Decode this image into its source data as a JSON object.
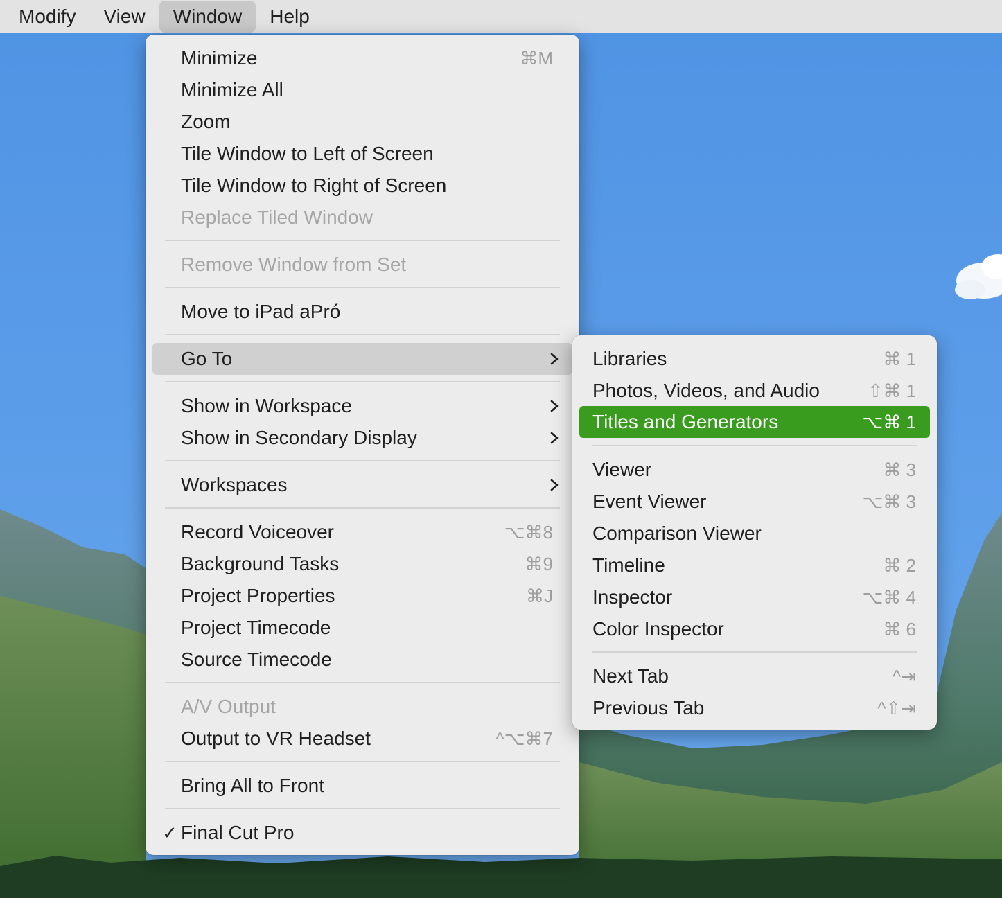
{
  "menubar": {
    "items": [
      {
        "label": "Modify"
      },
      {
        "label": "View"
      },
      {
        "label": "Window"
      },
      {
        "label": "Help"
      }
    ]
  },
  "window_menu": {
    "items": [
      {
        "label": "Minimize",
        "shortcut": "⌘M"
      },
      {
        "label": "Minimize All"
      },
      {
        "label": "Zoom"
      },
      {
        "label": "Tile Window to Left of Screen"
      },
      {
        "label": "Tile Window to Right of Screen"
      },
      {
        "label": "Replace Tiled Window",
        "disabled": true
      },
      {
        "label": "Remove Window from Set",
        "disabled": true
      },
      {
        "label": "Move to iPad aPró"
      },
      {
        "label": "Go To",
        "submenu": true,
        "highlighted": true
      },
      {
        "label": "Show in Workspace",
        "submenu": true
      },
      {
        "label": "Show in Secondary Display",
        "submenu": true
      },
      {
        "label": "Workspaces",
        "submenu": true
      },
      {
        "label": "Record Voiceover",
        "shortcut": "⌥⌘8"
      },
      {
        "label": "Background Tasks",
        "shortcut": "⌘9"
      },
      {
        "label": "Project Properties",
        "shortcut": "⌘J"
      },
      {
        "label": "Project Timecode"
      },
      {
        "label": "Source Timecode"
      },
      {
        "label": "A/V Output",
        "disabled": true
      },
      {
        "label": "Output to VR Headset",
        "shortcut": "^⌥⌘7"
      },
      {
        "label": "Bring All to Front"
      },
      {
        "label": "Final Cut Pro",
        "checked": true,
        "check_glyph": "✓"
      }
    ]
  },
  "goto_submenu": {
    "items": [
      {
        "label": "Libraries",
        "shortcut": "⌘ 1"
      },
      {
        "label": "Photos, Videos, and Audio",
        "shortcut": "⇧⌘ 1"
      },
      {
        "label": "Titles and Generators",
        "shortcut": "⌥⌘ 1",
        "highlighted": true
      },
      {
        "label": "Viewer",
        "shortcut": "⌘ 3"
      },
      {
        "label": "Event Viewer",
        "shortcut": "⌥⌘ 3"
      },
      {
        "label": "Comparison Viewer"
      },
      {
        "label": "Timeline",
        "shortcut": "⌘ 2"
      },
      {
        "label": "Inspector",
        "shortcut": "⌥⌘ 4"
      },
      {
        "label": "Color Inspector",
        "shortcut": "⌘ 6"
      },
      {
        "label": "Next Tab",
        "shortcut": "^⇥"
      },
      {
        "label": "Previous Tab",
        "shortcut": "^⇧⇥"
      }
    ]
  },
  "colors": {
    "highlight_green": "#399c1e",
    "highlight_gray": "#d0d0d0",
    "menu_bg": "#ececec",
    "menubar_bg": "#e3e3e3",
    "disabled_text": "#a6a6a6"
  }
}
